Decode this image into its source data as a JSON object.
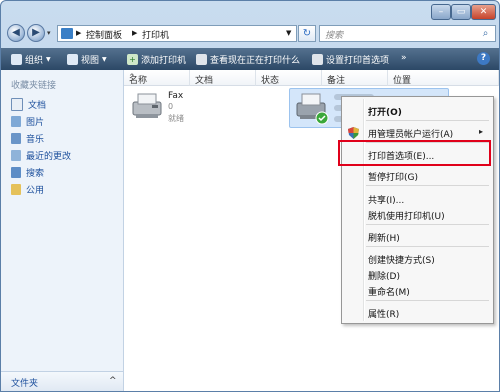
{
  "address": {
    "separator_prefix": "▶",
    "crumb1": "控制面板",
    "crumb_sep": "▶",
    "crumb2": "打印机",
    "dropdown": "▼"
  },
  "search": {
    "placeholder": "搜索"
  },
  "toolbar": {
    "organize": "组织",
    "views": "视图",
    "add_printer": "添加打印机",
    "see_printing": "查看现在正在打印什么",
    "set_prefs": "设置打印首选项",
    "more": "»",
    "help": "?"
  },
  "sidebar": {
    "header": "收藏夹链接",
    "items": [
      {
        "label": "文档",
        "icon": "document-icon"
      },
      {
        "label": "图片",
        "icon": "pictures-icon"
      },
      {
        "label": "音乐",
        "icon": "music-icon"
      },
      {
        "label": "最近的更改",
        "icon": "recent-changes-icon"
      },
      {
        "label": "搜索",
        "icon": "search-icon"
      },
      {
        "label": "公用",
        "icon": "public-folder-icon"
      }
    ],
    "folders_label": "文件夹",
    "folders_chevron": "^"
  },
  "columns": [
    "名称",
    "文档",
    "状态",
    "备注",
    "位置"
  ],
  "printers": [
    {
      "name": "Fax",
      "documents": "0",
      "status": "就绪"
    }
  ],
  "context_menu": {
    "items": [
      {
        "label": "打开(O)",
        "bold": true
      },
      {
        "label": "用管理员帐户运行(A)",
        "submenu": "▸"
      },
      {
        "label": "打印首选项(E)..."
      },
      {
        "label": "暂停打印(G)"
      },
      {
        "label": "共享(I)..."
      },
      {
        "label": "脱机使用打印机(U)"
      },
      {
        "label": "刷新(H)"
      },
      {
        "label": "创建快捷方式(S)"
      },
      {
        "label": "删除(D)"
      },
      {
        "label": "重命名(M)"
      },
      {
        "label": "属性(R)"
      }
    ],
    "highlight_color": "#e0001a"
  },
  "colors": {
    "toolbar": "#3a5778",
    "selection": "#d4e6fa",
    "link": "#1c4f9c"
  }
}
